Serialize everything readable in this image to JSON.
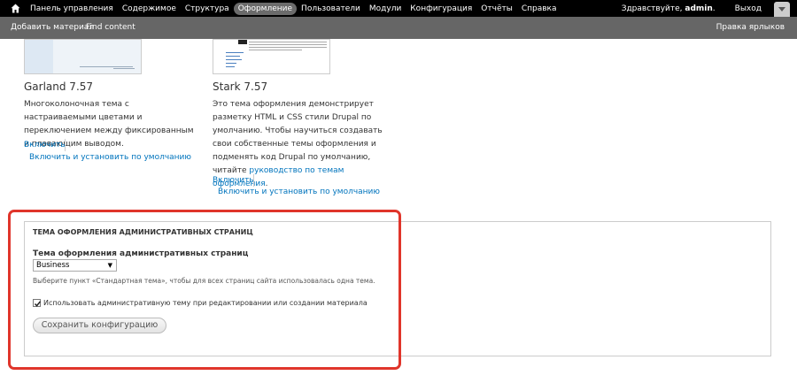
{
  "toolbar": {
    "menu": [
      {
        "label": "Панель управления"
      },
      {
        "label": "Содержимое"
      },
      {
        "label": "Структура"
      },
      {
        "label": "Оформление",
        "active": true
      },
      {
        "label": "Пользователи"
      },
      {
        "label": "Модули"
      },
      {
        "label": "Конфигурация"
      },
      {
        "label": "Отчёты"
      },
      {
        "label": "Справка"
      }
    ],
    "greeting_prefix": "Здравствуйте, ",
    "username": "admin",
    "greeting_suffix": ".",
    "logout": "Выход"
  },
  "shortcuts": {
    "add_content": "Добавить материал",
    "find_content": "Find content",
    "edit_shortcuts": "Правка ярлыков"
  },
  "themes": {
    "garland": {
      "title": "Garland 7.57",
      "description": "Многоколоночная тема с настраиваемыми цветами и переключением между фиксированным и плавающим выводом.",
      "enable": "Включить",
      "enable_default": "Включить и установить по умолчанию"
    },
    "stark": {
      "title": "Stark 7.57",
      "description": "Это тема оформления демонстрирует разметку HTML и CSS стили Drupal по умолчанию. Чтобы научиться создавать свои собственные темы оформления и подменять код Drupal по умолчанию, читайте ",
      "description_link": "руководство по темам оформления",
      "description_end": ".",
      "enable": "Включить",
      "enable_default": "Включить и установить по умолчанию"
    }
  },
  "admin_theme": {
    "legend": "ТЕМА ОФОРМЛЕНИЯ АДМИНИСТРАТИВНЫХ СТРАНИЦ",
    "field_label": "Тема оформления административных страниц",
    "selected": "Business",
    "hint": "Выберите пункт «Стандартная тема», чтобы для всех страниц сайта использовалась одна тема.",
    "checkbox_label": "Использовать административную тему при редактировании или создании материала",
    "checkbox_checked": true,
    "save_button": "Сохранить конфигурацию"
  },
  "colors": {
    "toolbar_bg": "#000000",
    "shortcut_bg": "#666666",
    "link": "#0074bd",
    "highlight": "#e0352b"
  }
}
